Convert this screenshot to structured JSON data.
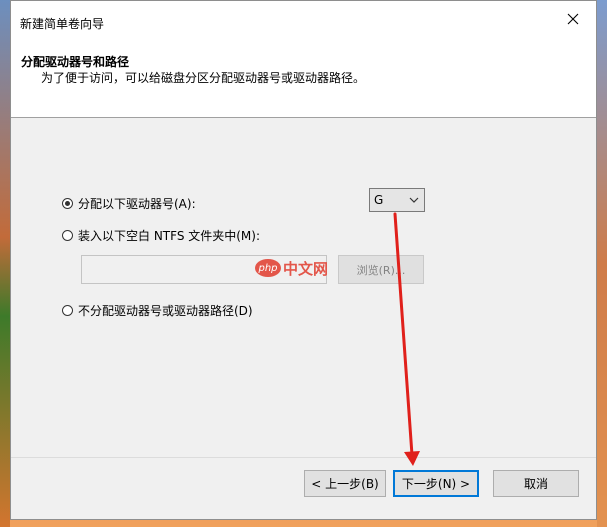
{
  "window": {
    "title": "新建简单卷向导"
  },
  "header": {
    "title": "分配驱动器号和路径",
    "subtitle": "为了便于访问，可以给磁盘分区分配驱动器号或驱动器路径。"
  },
  "options": {
    "assign_letter": {
      "label": "分配以下驱动器号(A):",
      "checked": true
    },
    "mount_folder": {
      "label": "装入以下空白 NTFS 文件夹中(M):",
      "checked": false
    },
    "no_assign": {
      "label": "不分配驱动器号或驱动器路径(D)",
      "checked": false
    }
  },
  "drive_select": {
    "value": "G"
  },
  "folder_path": {
    "value": "",
    "browse_label": "浏览(R)..."
  },
  "watermark": {
    "badge": "php",
    "text": "中文网"
  },
  "buttons": {
    "back": "< 上一步(B)",
    "next": "下一步(N) >",
    "cancel": "取消"
  },
  "colors": {
    "accent": "#0078d7",
    "annotation_arrow": "#e0201b"
  }
}
